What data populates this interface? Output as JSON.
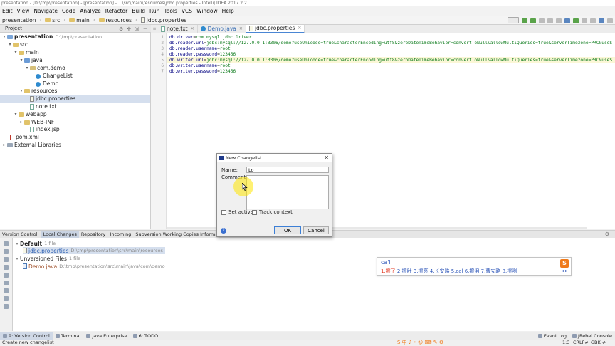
{
  "window": {
    "title": "presentation - [D:\\tmp\\presentation] - [presentation] - ...\\src\\main\\resources\\jdbc.properties - IntelliJ IDEA 2017.2.2"
  },
  "menu": [
    "Edit",
    "View",
    "Navigate",
    "Code",
    "Analyze",
    "Refactor",
    "Build",
    "Run",
    "Tools",
    "VCS",
    "Window",
    "Help"
  ],
  "breadcrumb": [
    "presentation",
    "src",
    "main",
    "resources",
    "jdbc.properties"
  ],
  "project_panel": {
    "title": "Project",
    "tree": [
      {
        "label": "presentation",
        "path": "D:\\tmp\\presentation",
        "type": "module",
        "arrow": "▾"
      },
      {
        "label": "src",
        "type": "folder",
        "arrow": "▾"
      },
      {
        "label": "main",
        "type": "folder",
        "arrow": "▾"
      },
      {
        "label": "java",
        "type": "folder",
        "arrow": "▾"
      },
      {
        "label": "com.demo",
        "type": "package",
        "arrow": "▾"
      },
      {
        "label": "ChangeList",
        "type": "class",
        "arrow": ""
      },
      {
        "label": "Demo",
        "type": "class",
        "arrow": ""
      },
      {
        "label": "resources",
        "type": "folder",
        "arrow": "▾"
      },
      {
        "label": "jdbc.properties",
        "type": "props",
        "arrow": ""
      },
      {
        "label": "note.txt",
        "type": "file",
        "arrow": ""
      },
      {
        "label": "webapp",
        "type": "folder",
        "arrow": "▾"
      },
      {
        "label": "WEB-INF",
        "type": "folder",
        "arrow": "▸"
      },
      {
        "label": "index.jsp",
        "type": "file",
        "arrow": ""
      },
      {
        "label": "pom.xml",
        "type": "file",
        "arrow": ""
      },
      {
        "label": "External Libraries",
        "type": "lib",
        "arrow": "▸"
      }
    ]
  },
  "editor_tabs": [
    {
      "label": "note.txt"
    },
    {
      "label": "Demo.java"
    },
    {
      "label": "jdbc.properties"
    }
  ],
  "editor_lines": [
    {
      "n": "1",
      "key": "db.driver",
      "val": "com.mysql.jdbc.Driver"
    },
    {
      "n": "2",
      "key": "db.reader.url",
      "val": "jdbc:mysql://127.0.0.1:3306/demo?useUnicode=true&characterEncoding=utf8&zeroDateTimeBehavior=convertToNull&allowMultiQueries=true&serverTimezone=PRC&useS"
    },
    {
      "n": "3",
      "key": "db.reader.username",
      "val": "root"
    },
    {
      "n": "4",
      "key": "db.reader.password",
      "val": "123456"
    },
    {
      "n": "5",
      "key": "db.writer.url",
      "val": "jdbc:mysql://127.0.0.1:3306/demo?useUnicode=true&characterEncoding=utf8&zeroDateTimeBehavior=convertToNull&allowMultiQueries=true&serverTimezone=PRC&useS"
    },
    {
      "n": "6",
      "key": "db.writer.username",
      "val": "root"
    },
    {
      "n": "7",
      "key": "db.writer.password",
      "val": "123456"
    }
  ],
  "version_control": {
    "tabs": [
      "Version Control:",
      "Local Changes",
      "Repository",
      "Incoming",
      "Subversion Working Copies Information"
    ],
    "default_label": "Default",
    "default_count": "1 file",
    "default_file": "jdbc.properties",
    "default_path": "D:\\tmp\\presentation\\src\\main\\resources",
    "unversioned_label": "Unversioned Files",
    "unversioned_count": "1 file",
    "unversioned_file": "Demo.java",
    "unversioned_path": "D:\\tmp\\presentation\\src\\main\\java\\com\\demo"
  },
  "dialog": {
    "title": "New Changelist",
    "name_label": "Name:",
    "name_value": "Lo",
    "comment_label": "Comment:",
    "set_active_label": "Set active",
    "track_context_label": "Track context",
    "ok_label": "OK",
    "cancel_label": "Cancel",
    "help_glyph": "?"
  },
  "ime": {
    "composition": "ca'l",
    "candidates": [
      "1.擦了",
      "2.擦肚",
      "3.擦亮",
      "4.长安路",
      "5.cal",
      "6.擦泪",
      "7.曹安路",
      "8.擦咧"
    ],
    "logo": "S",
    "pager": "◂ ▸"
  },
  "tool_strip": [
    "9: Version Control",
    "Terminal",
    "Java Enterprise",
    "6: TODO",
    "Event Log",
    "JRebel Console"
  ],
  "status": {
    "message": "Create new changelist",
    "position": "1:3",
    "line_sep": "CRLF≠",
    "encoding": "GBK ≠"
  },
  "colors": {
    "selection": "#d5dfee",
    "active_tab": "#4a86d4",
    "prop_value": "#0a7a1a",
    "prop_key": "#000080",
    "cursor_highlight": "#ffe600"
  }
}
